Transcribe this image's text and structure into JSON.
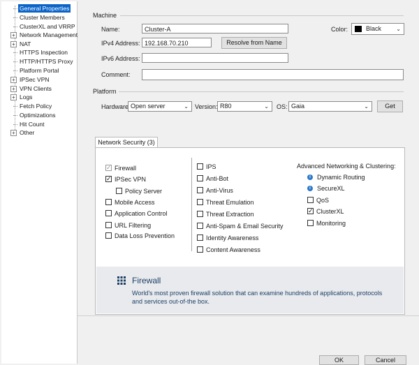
{
  "tree": {
    "items": [
      {
        "label": "General Properties",
        "selected": true,
        "expandable": false
      },
      {
        "label": "Cluster Members",
        "selected": false,
        "expandable": false
      },
      {
        "label": "ClusterXL and VRRP",
        "selected": false,
        "expandable": false
      },
      {
        "label": "Network Management",
        "selected": false,
        "expandable": true
      },
      {
        "label": "NAT",
        "selected": false,
        "expandable": true
      },
      {
        "label": "HTTPS Inspection",
        "selected": false,
        "expandable": false
      },
      {
        "label": "HTTP/HTTPS Proxy",
        "selected": false,
        "expandable": false
      },
      {
        "label": "Platform Portal",
        "selected": false,
        "expandable": false
      },
      {
        "label": "IPSec VPN",
        "selected": false,
        "expandable": true
      },
      {
        "label": "VPN Clients",
        "selected": false,
        "expandable": true
      },
      {
        "label": "Logs",
        "selected": false,
        "expandable": true
      },
      {
        "label": "Fetch Policy",
        "selected": false,
        "expandable": false
      },
      {
        "label": "Optimizations",
        "selected": false,
        "expandable": false
      },
      {
        "label": "Hit Count",
        "selected": false,
        "expandable": false
      },
      {
        "label": "Other",
        "selected": false,
        "expandable": true
      }
    ]
  },
  "machine": {
    "section_title": "Machine",
    "name_label": "Name:",
    "name_value": "Cluster-A",
    "color_label": "Color:",
    "color_value": "Black",
    "color_swatch": "#000000",
    "ipv4_label": "IPv4 Address:",
    "ipv4_value": "192.168.70.210",
    "resolve_label": "Resolve from Name",
    "ipv6_label": "IPv6 Address:",
    "ipv6_value": "",
    "comment_label": "Comment:",
    "comment_value": ""
  },
  "platform": {
    "section_title": "Platform",
    "hardware_label": "Hardware:",
    "hardware_value": "Open server",
    "version_label": "Version:",
    "version_value": "R80",
    "os_label": "OS:",
    "os_value": "Gaia",
    "get_label": "Get"
  },
  "tab": {
    "label": "Network Security (3)"
  },
  "blades": {
    "col1": [
      {
        "label": "Firewall",
        "checked": true,
        "disabled": true
      },
      {
        "label": "IPSec VPN",
        "checked": true,
        "disabled": false
      },
      {
        "label": "Policy Server",
        "checked": false,
        "disabled": false
      },
      {
        "label": "Mobile Access",
        "checked": false,
        "disabled": false
      },
      {
        "label": "Application Control",
        "checked": false,
        "disabled": false
      },
      {
        "label": "URL Filtering",
        "checked": false,
        "disabled": false
      },
      {
        "label": "Data Loss Prevention",
        "checked": false,
        "disabled": false
      }
    ],
    "col2": [
      {
        "label": "IPS",
        "checked": false
      },
      {
        "label": "Anti-Bot",
        "checked": false
      },
      {
        "label": "Anti-Virus",
        "checked": false
      },
      {
        "label": "Threat Emulation",
        "checked": false
      },
      {
        "label": "Threat Extraction",
        "checked": false
      },
      {
        "label": "Anti-Spam & Email Security",
        "checked": false
      },
      {
        "label": "Identity Awareness",
        "checked": false
      },
      {
        "label": "Content Awareness",
        "checked": false
      }
    ],
    "adv_title": "Advanced Networking & Clustering:",
    "adv": [
      {
        "label": "Dynamic Routing",
        "type": "info"
      },
      {
        "label": "SecureXL",
        "type": "info"
      },
      {
        "label": "QoS",
        "type": "check",
        "checked": false
      },
      {
        "label": "ClusterXL",
        "type": "check",
        "checked": true
      },
      {
        "label": "Monitoring",
        "type": "check",
        "checked": false
      }
    ]
  },
  "description": {
    "title": "Firewall",
    "text": "World's most proven firewall solution that can examine hundreds of applications, protocols and services out-of-the box."
  },
  "footer": {
    "ok_label": "OK",
    "cancel_label": "Cancel"
  }
}
